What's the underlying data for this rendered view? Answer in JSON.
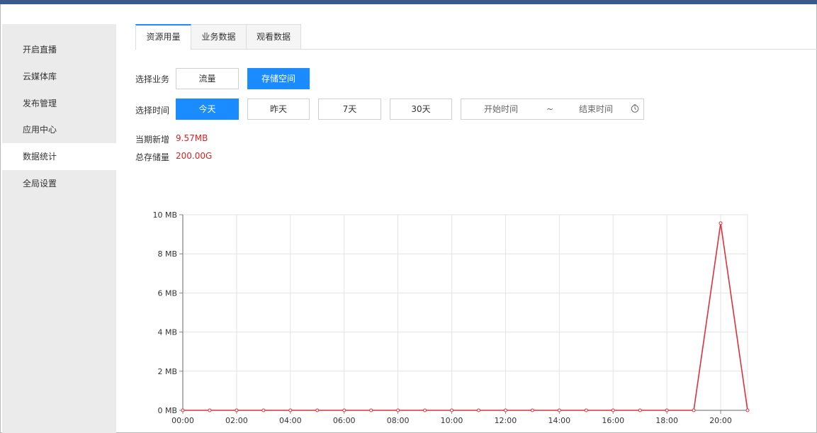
{
  "sidebar": {
    "items": [
      {
        "label": "开启直播"
      },
      {
        "label": "云媒体库"
      },
      {
        "label": "发布管理"
      },
      {
        "label": "应用中心"
      },
      {
        "label": "数据统计",
        "active": true
      },
      {
        "label": "全局设置"
      }
    ]
  },
  "tabs": [
    {
      "label": "资源用量",
      "active": true
    },
    {
      "label": "业务数据"
    },
    {
      "label": "观看数据"
    }
  ],
  "business": {
    "label": "选择业务",
    "options": [
      {
        "label": "流量"
      },
      {
        "label": "存储空间",
        "selected": true
      }
    ]
  },
  "time": {
    "label": "选择时间",
    "options": [
      {
        "label": "今天",
        "selected": true
      },
      {
        "label": "昨天"
      },
      {
        "label": "7天"
      },
      {
        "label": "30天"
      }
    ],
    "start_placeholder": "开始时间",
    "separator": "~",
    "end_placeholder": "结束时间"
  },
  "stats": {
    "new_label": "当期新增",
    "new_value": "9.57MB",
    "total_label": "总存储量",
    "total_value": "200.00G"
  },
  "colors": {
    "accent": "#1a8cff",
    "value_red": "#e02020",
    "line": "#e0303a"
  },
  "chart_data": {
    "type": "line",
    "x": [
      "00:00",
      "01:00",
      "02:00",
      "03:00",
      "04:00",
      "05:00",
      "06:00",
      "07:00",
      "08:00",
      "09:00",
      "10:00",
      "11:00",
      "12:00",
      "13:00",
      "14:00",
      "15:00",
      "16:00",
      "17:00",
      "18:00",
      "19:00",
      "20:00",
      "21:00"
    ],
    "xticks": [
      "00:00",
      "02:00",
      "04:00",
      "06:00",
      "08:00",
      "10:00",
      "12:00",
      "14:00",
      "16:00",
      "18:00",
      "20:00"
    ],
    "values": [
      0,
      0,
      0,
      0,
      0,
      0,
      0,
      0,
      0,
      0,
      0,
      0,
      0,
      0,
      0,
      0,
      0,
      0,
      0,
      0,
      9.57,
      0
    ],
    "yticks": [
      "0 MB",
      "2 MB",
      "4 MB",
      "6 MB",
      "8 MB",
      "10 MB"
    ],
    "ylim": [
      0,
      10
    ],
    "grid": true
  }
}
